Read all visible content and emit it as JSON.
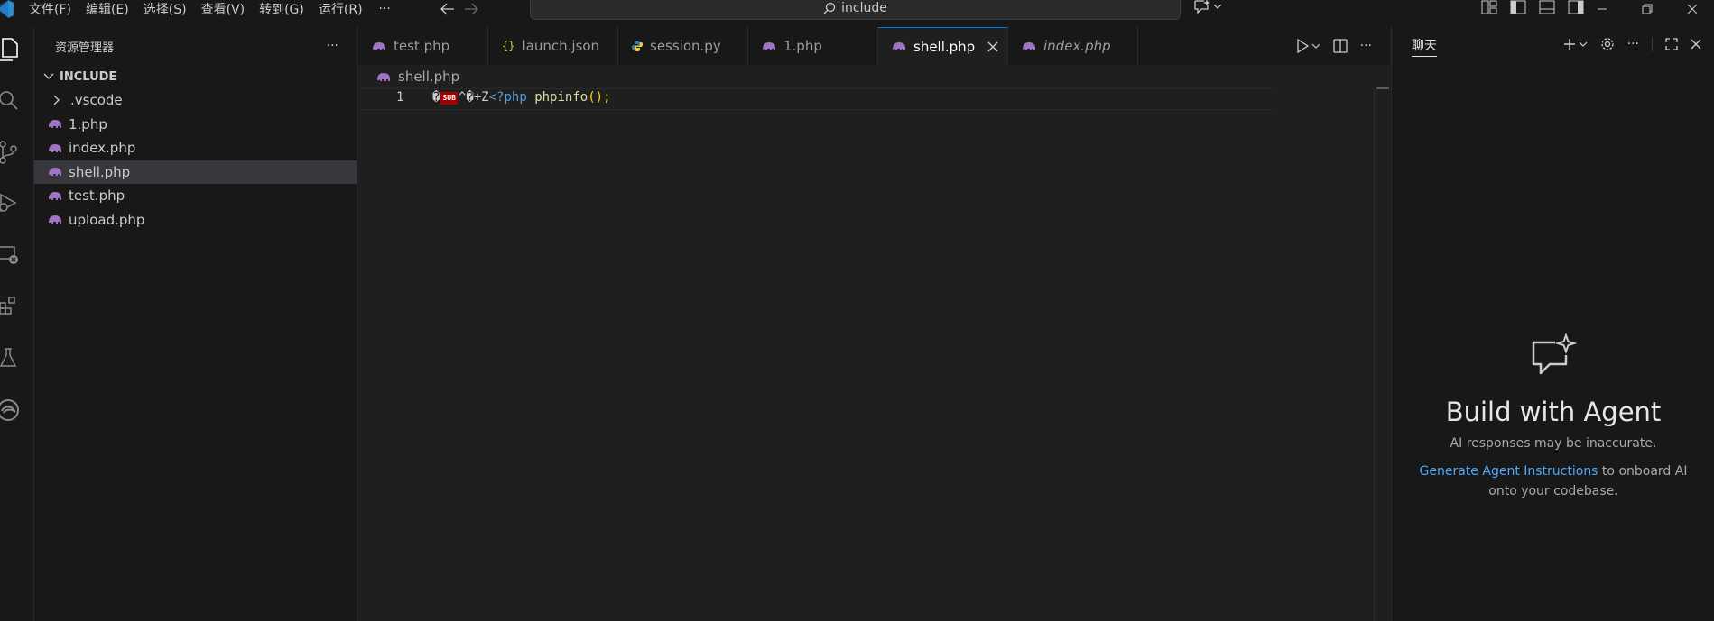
{
  "titlebar": {
    "menu": [
      "文件(F)",
      "编辑(E)",
      "选择(S)",
      "查看(V)",
      "转到(G)",
      "运行(R)"
    ],
    "more": "···",
    "search_text": "include"
  },
  "sidebar": {
    "title": "资源管理器",
    "more": "···",
    "section": "INCLUDE",
    "items": [
      {
        "label": ".vscode",
        "type": "folder"
      },
      {
        "label": "1.php",
        "type": "php"
      },
      {
        "label": "index.php",
        "type": "php"
      },
      {
        "label": "shell.php",
        "type": "php",
        "selected": true
      },
      {
        "label": "test.php",
        "type": "php"
      },
      {
        "label": "upload.php",
        "type": "php"
      }
    ]
  },
  "tabs": [
    {
      "label": "test.php",
      "icon": "php-icon"
    },
    {
      "label": "launch.json",
      "icon": "json-icon"
    },
    {
      "label": "session.py",
      "icon": "python-icon"
    },
    {
      "label": "1.php",
      "icon": "php-icon"
    },
    {
      "label": "shell.php",
      "icon": "php-icon",
      "active": true
    },
    {
      "label": "index.php",
      "icon": "php-icon",
      "italic": true
    }
  ],
  "editor": {
    "breadcrumb": "shell.php",
    "line_number": "1",
    "code": {
      "garbage1": "�",
      "sub_badge": "SUB",
      "garbage2": "^�+Z",
      "php_open": "<?php",
      "space": " ",
      "func": "phpinfo",
      "parens": "();"
    }
  },
  "chat": {
    "tab": "聊天",
    "heading": "Build with Agent",
    "sub": "AI responses may be inaccurate.",
    "link": "Generate Agent Instructions",
    "desc_rest": " to onboard AI onto your codebase."
  },
  "colors": {
    "accent": "#0078d4",
    "link": "#4daafc",
    "php_icon": "#a074c4",
    "json_icon": "#cbcb41",
    "python_icon": "#3c78aa",
    "code_keyword": "#569cd6",
    "code_function": "#dcdcaa",
    "code_paren": "#ffd700"
  }
}
